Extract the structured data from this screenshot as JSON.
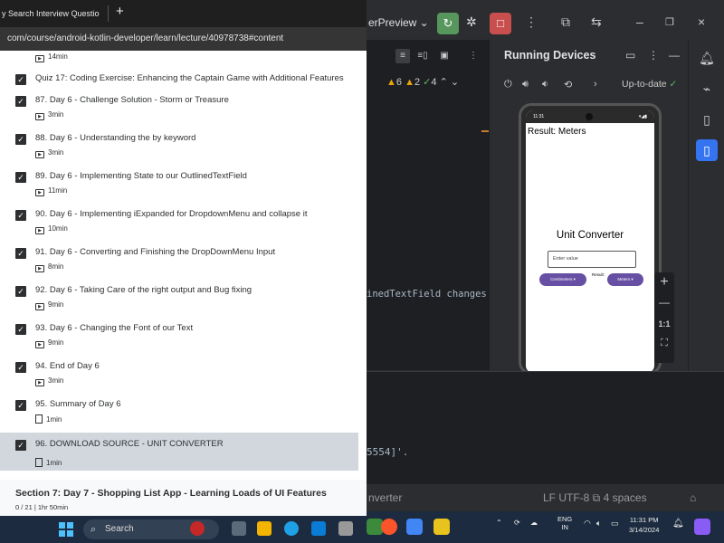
{
  "browser": {
    "tab_title": "y Search Interview Questio",
    "new_tab": "+",
    "url": "com/course/android-kotlin-developer/learn/lecture/40978738#content"
  },
  "course": {
    "items": [
      {
        "title": "",
        "meta": "14min",
        "type": "video",
        "checked": false
      },
      {
        "title": "Quiz 17: Coding Exercise: Enhancing the Captain Game with Additional Features",
        "meta": "",
        "type": "quiz",
        "checked": true
      },
      {
        "title": "87. Day 6 - Challenge Solution - Storm or Treasure",
        "meta": "3min",
        "type": "video",
        "checked": true
      },
      {
        "title": "88. Day 6 - Understanding the by keyword",
        "meta": "3min",
        "type": "video",
        "checked": true
      },
      {
        "title": "89. Day 6 - Implementing State to our OutlinedTextField",
        "meta": "11min",
        "type": "video",
        "checked": true
      },
      {
        "title": "90. Day 6 - Implementing iExpanded for DropdownMenu and collapse it",
        "meta": "10min",
        "type": "video",
        "checked": true
      },
      {
        "title": "91. Day 6 - Converting and Finishing the DropDownMenu Input",
        "meta": "8min",
        "type": "video",
        "checked": true
      },
      {
        "title": "92. Day 6 - Taking Care of the right output and Bug fixing",
        "meta": "9min",
        "type": "video",
        "checked": true
      },
      {
        "title": "93. Day 6 - Changing the Font of our Text",
        "meta": "9min",
        "type": "video",
        "checked": true
      },
      {
        "title": "94. End of Day 6",
        "meta": "3min",
        "type": "video",
        "checked": true
      },
      {
        "title": "95. Summary of Day 6",
        "meta": "1min",
        "type": "file",
        "checked": true
      },
      {
        "title": "96. DOWNLOAD SOURCE - UNIT CONVERTER",
        "meta": "1min",
        "type": "file",
        "checked": true
      }
    ],
    "section_title": "Section 7: Day 7 - Shopping List App - Learning Loads of UI Features",
    "section_meta": "0 / 21 | 1hr 50min"
  },
  "taskbar_left": {
    "search_label": "Search"
  },
  "studio": {
    "run_config": "erPreview ⌄",
    "warnings": "6",
    "weak_warnings": "2",
    "typos": "4",
    "code_fragment": "inedTextField changes",
    "log_fragment": "5554]'.",
    "status_left": "nverter",
    "status_right": "LF   UTF-8   ⧉   4 spaces",
    "running_devices_title": "Running Devices",
    "up_to_date": "Up-to-date"
  },
  "phone": {
    "status_time": "11:31",
    "result_top": "Result:  Meters",
    "title": "Unit Converter",
    "input_placeholder": "Enter value",
    "from_button": "Centimeters ▾",
    "result_label": "Result:",
    "to_button": "Meters ▾"
  },
  "emulator_controls": {
    "zoom_in": "+",
    "zoom_out": "—",
    "actual_size": "1:1"
  },
  "taskbar_right": {
    "lang_top": "ENG",
    "lang_bottom": "IN",
    "time": "11:31 PM",
    "date": "3/14/2024"
  },
  "colors": {
    "accent_purple": "#6750a4",
    "checkbox": "#2d2f31",
    "active_item": "#d1d7dc",
    "warning": "#e5a50a",
    "ok_green": "#5fb865",
    "run_green": "#57965c",
    "stop_red": "#c94f4f"
  }
}
